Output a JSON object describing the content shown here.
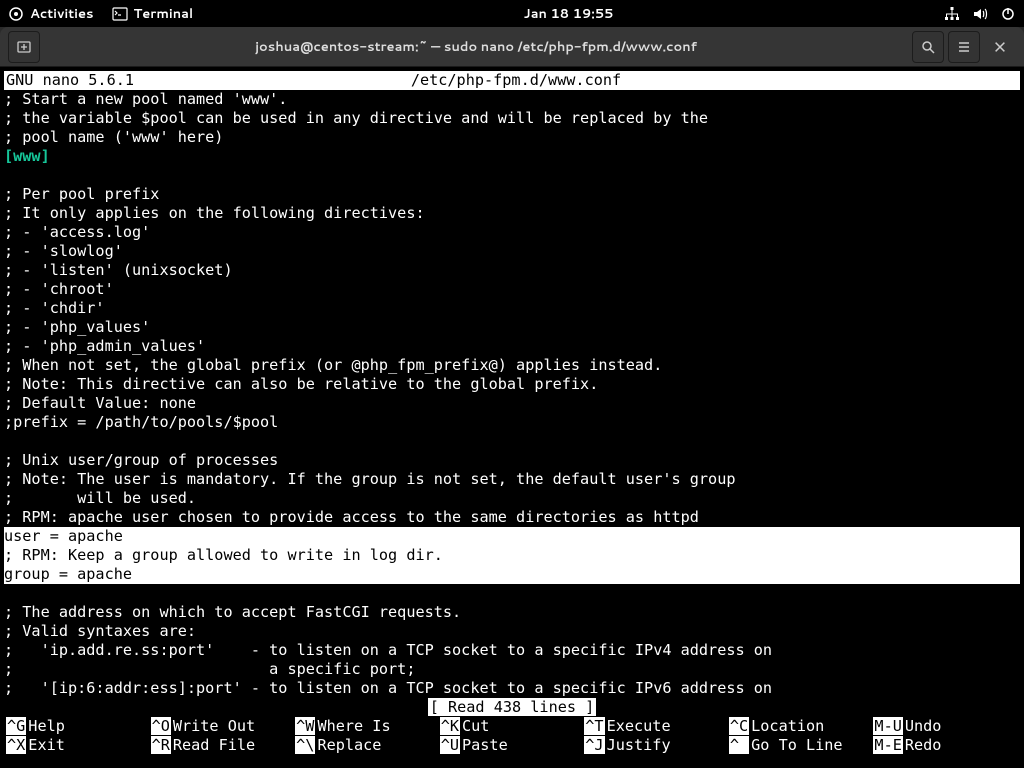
{
  "topbar": {
    "activities": "Activities",
    "app": "Terminal",
    "datetime": "Jan 18  19:55"
  },
  "window": {
    "title": "joshua@centos-stream:~ — sudo nano /etc/php-fpm.d/www.conf"
  },
  "nano": {
    "version": "GNU nano 5.6.1",
    "filepath": "/etc/php-fpm.d/www.conf",
    "status": "[ Read 438 lines ]"
  },
  "content": {
    "pre_pool": "; Start a new pool named 'www'.\n; the variable $pool can be used in any directive and will be replaced by the\n; pool name ('www' here)",
    "pool": "[www]",
    "mid": "\n; Per pool prefix\n; It only applies on the following directives:\n; - 'access.log'\n; - 'slowlog'\n; - 'listen' (unixsocket)\n; - 'chroot'\n; - 'chdir'\n; - 'php_values'\n; - 'php_admin_values'\n; When not set, the global prefix (or @php_fpm_prefix@) applies instead.\n; Note: This directive can also be relative to the global prefix.\n; Default Value: none\n;prefix = /path/to/pools/$pool\n\n; Unix user/group of processes\n; Note: The user is mandatory. If the group is not set, the default user's group\n;       will be used.\n; RPM: apache user chosen to provide access to the same directories as httpd",
    "hl": "user = apache\n; RPM: Keep a group allowed to write in log dir.\ngroup = apache",
    "post": "\n; The address on which to accept FastCGI requests.\n; Valid syntaxes are:\n;   'ip.add.re.ss:port'    - to listen on a TCP socket to a specific IPv4 address on\n;                            a specific port;\n;   '[ip:6:addr:ess]:port' - to listen on a TCP socket to a specific IPv6 address on"
  },
  "shortcuts": [
    {
      "k": "^G",
      "l": "Help"
    },
    {
      "k": "^O",
      "l": "Write Out"
    },
    {
      "k": "^W",
      "l": "Where Is"
    },
    {
      "k": "^K",
      "l": "Cut"
    },
    {
      "k": "^T",
      "l": "Execute"
    },
    {
      "k": "^C",
      "l": "Location"
    },
    {
      "k": "M-U",
      "l": "Undo"
    },
    {
      "k": "^X",
      "l": "Exit"
    },
    {
      "k": "^R",
      "l": "Read File"
    },
    {
      "k": "^\\",
      "l": "Replace"
    },
    {
      "k": "^U",
      "l": "Paste"
    },
    {
      "k": "^J",
      "l": "Justify"
    },
    {
      "k": "^ ",
      "l": "Go To Line"
    },
    {
      "k": "M-E",
      "l": "Redo"
    }
  ]
}
